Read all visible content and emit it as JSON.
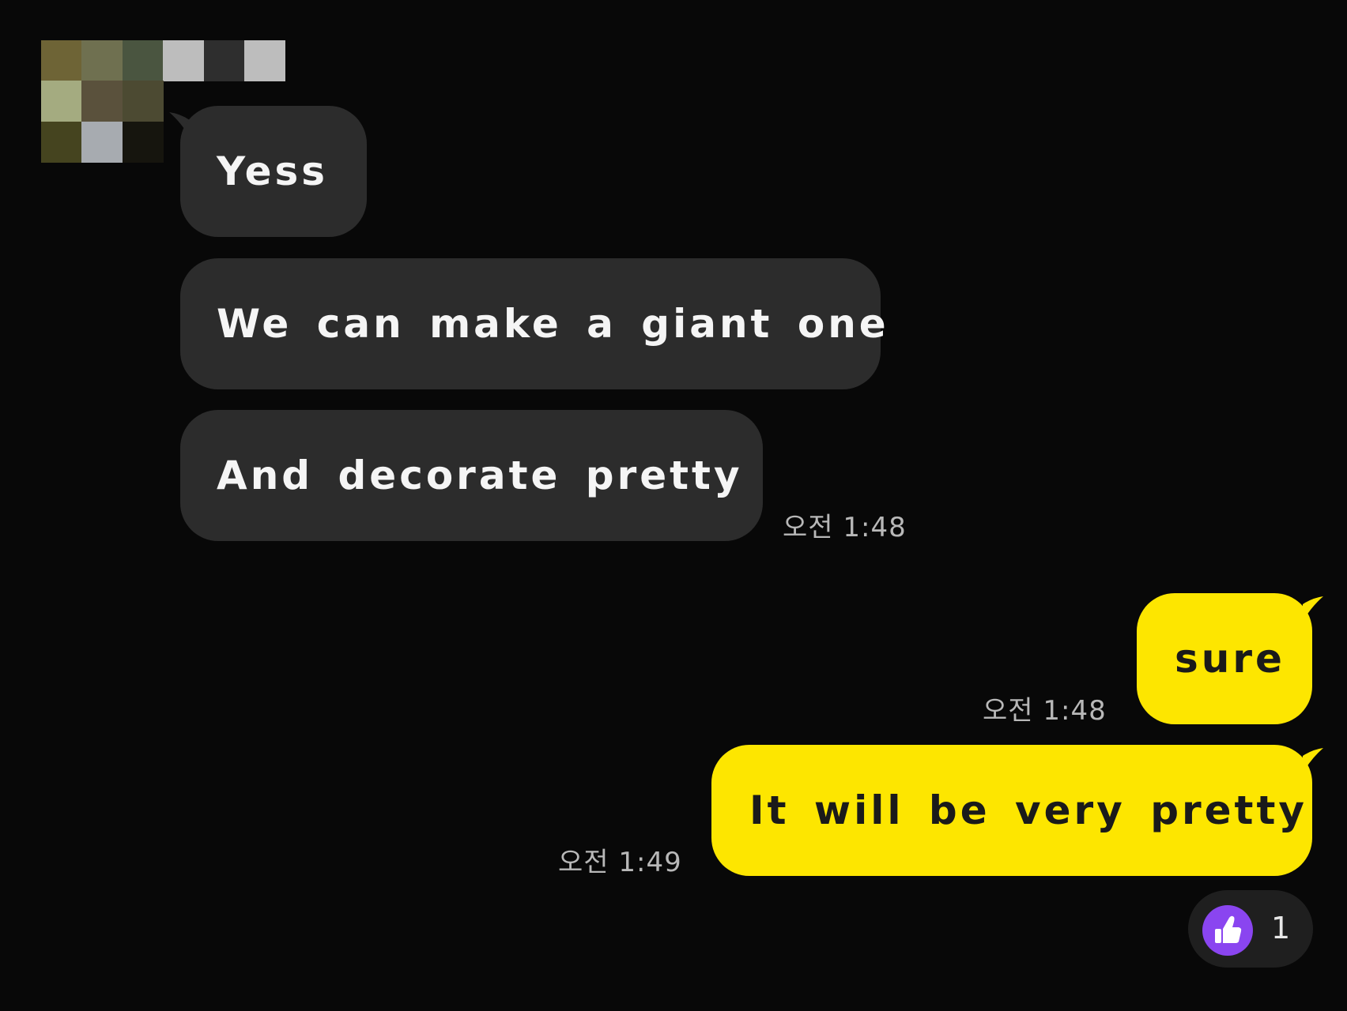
{
  "conversation": {
    "incoming": [
      {
        "text": "Yess"
      },
      {
        "text": "We can make a giant one"
      },
      {
        "text": "And decorate pretty",
        "time": "오전 1:48"
      }
    ],
    "outgoing": [
      {
        "text": "sure",
        "time": "오전 1:48"
      },
      {
        "text": "It will be very pretty",
        "time": "오전 1:49"
      }
    ]
  },
  "reaction": {
    "icon": "thumbs-up-icon",
    "count": "1",
    "color": "#8a45f0"
  },
  "colors": {
    "background": "#080808",
    "incoming_bubble": "#2c2c2c",
    "outgoing_bubble": "#fde600",
    "timestamp": "#b8b8b8"
  }
}
